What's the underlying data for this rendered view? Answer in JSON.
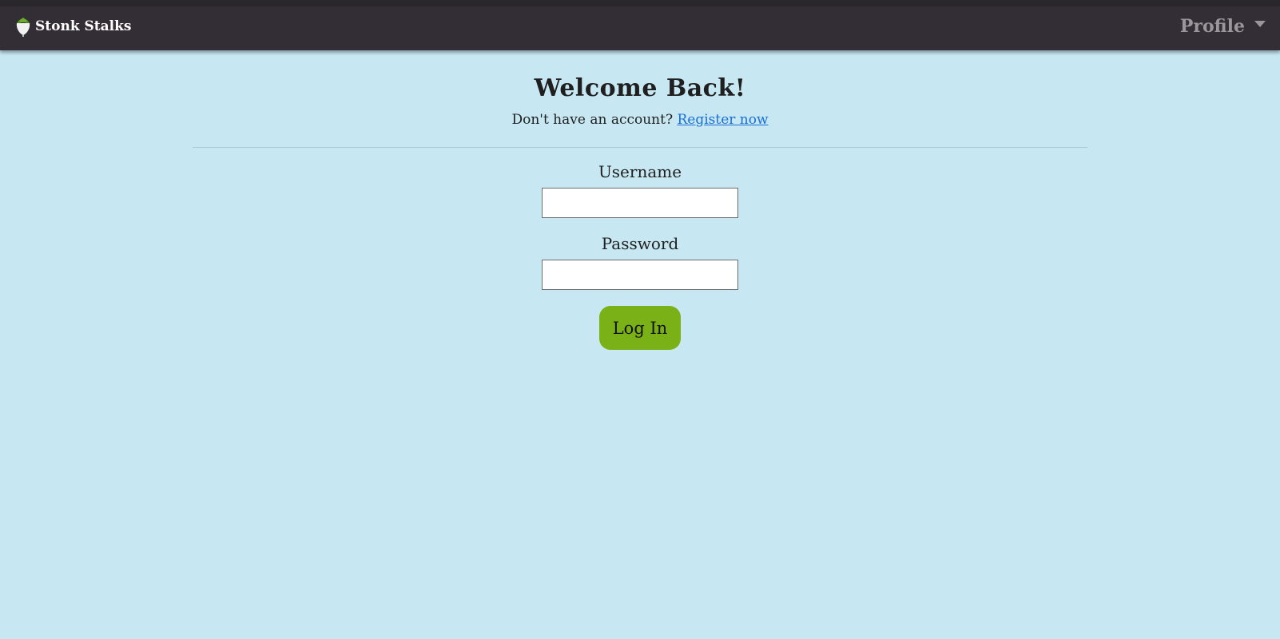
{
  "navbar": {
    "brand_name": "Stonk Stalks",
    "brand_icon": "turnip-icon",
    "profile_label": "Profile"
  },
  "login": {
    "title": "Welcome Back!",
    "subtitle_text": "Don't have an account?",
    "register_link": "Register now",
    "username_label": "Username",
    "username_value": "",
    "password_label": "Password",
    "password_value": "",
    "submit_label": "Log In"
  },
  "colors": {
    "background": "#c7e8f3",
    "navbar": "#332e35",
    "button": "#79b117",
    "link": "#1a6fd6"
  }
}
